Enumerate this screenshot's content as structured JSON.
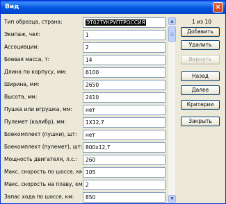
{
  "window": {
    "title": "Вид",
    "close_glyph": "×"
  },
  "fields": [
    {
      "label": "Тип образца, страна:",
      "value": "ЭТ02ТУКРУПТРОССИЯ",
      "selected": true
    },
    {
      "label": "Экипаж, чел:",
      "value": "1"
    },
    {
      "label": "Ассоциации:",
      "value": "2"
    },
    {
      "label": "Боевая масса, т:",
      "value": "14"
    },
    {
      "label": "Длина по корпусу, мм:",
      "value": "6100"
    },
    {
      "label": "Ширина, мм:",
      "value": "2650"
    },
    {
      "label": "Высота, мм:",
      "value": "2410"
    },
    {
      "label": "Пушка или игрушка, мм:",
      "value": "нет"
    },
    {
      "label": "Пулемет (калибр), мм:",
      "value": "1Х12,7"
    },
    {
      "label": "Боекомплект (пушки), шт:",
      "value": "нет"
    },
    {
      "label": "Боекомплект (пулемет), шт:",
      "value": "800х12,7"
    },
    {
      "label": "Мощность двигателя, л.с.:",
      "value": "260"
    },
    {
      "label": "Макс. скорость по шоссе, км/ч:",
      "value": "105"
    },
    {
      "label": "Макс. скорость на плаву, км/ч:",
      "value": "2"
    },
    {
      "label": "Запас хода по шоссе, км:",
      "value": "850"
    }
  ],
  "record_counter": "1 из 10",
  "buttons": [
    {
      "label": "Добавить",
      "disabled": false,
      "focused": true
    },
    {
      "label": "Удалить",
      "disabled": false
    },
    {
      "label": "Вернуть",
      "disabled": true
    },
    {
      "label": "Назад",
      "disabled": false
    },
    {
      "label": "Далее",
      "disabled": false
    },
    {
      "label": "Критерии",
      "disabled": false
    },
    {
      "label": "Закрыть",
      "disabled": false
    }
  ],
  "scrollbar": {
    "up_glyph": "▲",
    "down_glyph": "▼"
  }
}
